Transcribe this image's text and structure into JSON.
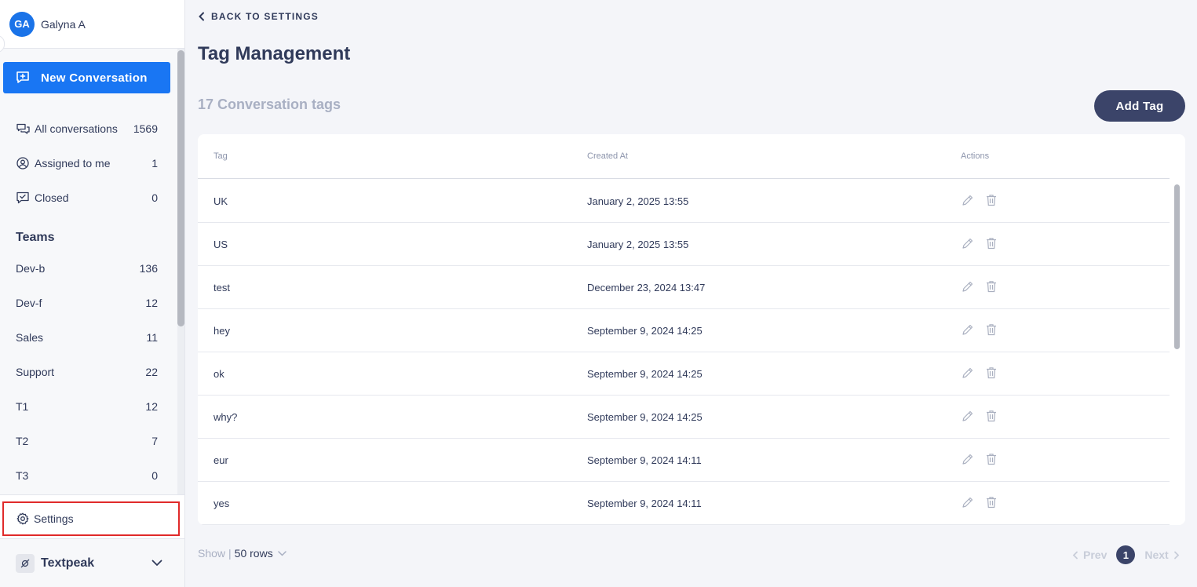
{
  "user": {
    "initials": "GA",
    "name": "Galyna A"
  },
  "new_conversation_label": "New Conversation",
  "nav": [
    {
      "label": "All conversations",
      "count": "1569",
      "icon": "chat-bubbles-icon"
    },
    {
      "label": "Assigned to me",
      "count": "1",
      "icon": "user-circle-icon"
    },
    {
      "label": "Closed",
      "count": "0",
      "icon": "closed-chat-icon"
    }
  ],
  "teams_heading": "Teams",
  "teams": [
    {
      "label": "Dev-b",
      "count": "136"
    },
    {
      "label": "Dev-f",
      "count": "12"
    },
    {
      "label": "Sales",
      "count": "11"
    },
    {
      "label": "Support",
      "count": "22"
    },
    {
      "label": "T1",
      "count": "12"
    },
    {
      "label": "T2",
      "count": "7"
    },
    {
      "label": "T3",
      "count": "0"
    }
  ],
  "settings_label": "Settings",
  "workspace": {
    "name": "Textpeak"
  },
  "back_label": "BACK TO SETTINGS",
  "page_title": "Tag Management",
  "tag_count_label": "17 Conversation tags",
  "add_tag_label": "Add Tag",
  "table": {
    "columns": [
      "Tag",
      "Created At",
      "Actions"
    ],
    "rows": [
      {
        "tag": "UK",
        "created": "January 2, 2025 13:55"
      },
      {
        "tag": "US",
        "created": "January 2, 2025 13:55"
      },
      {
        "tag": "test",
        "created": "December 23, 2024 13:47"
      },
      {
        "tag": "hey",
        "created": "September 9, 2024 14:25"
      },
      {
        "tag": "ok",
        "created": "September 9, 2024 14:25"
      },
      {
        "tag": "why?",
        "created": "September 9, 2024 14:25"
      },
      {
        "tag": "eur",
        "created": "September 9, 2024 14:11"
      },
      {
        "tag": "yes",
        "created": "September 9, 2024 14:11"
      }
    ]
  },
  "pagination": {
    "show_label": "Show",
    "separator": "|",
    "rows_label": "50 rows",
    "prev_label": "Prev",
    "current_page": "1",
    "next_label": "Next"
  },
  "colors": {
    "primary_blue": "#1976f3",
    "navy": "#3b4469",
    "highlight_red": "#e02a2a"
  }
}
